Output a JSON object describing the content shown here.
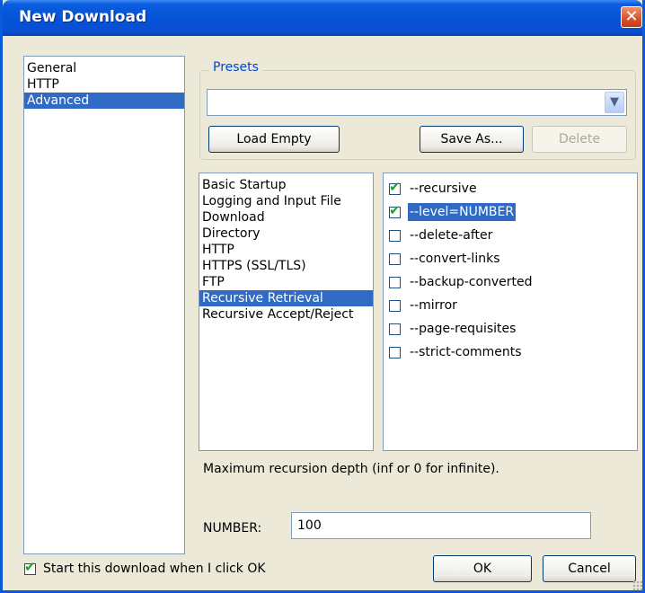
{
  "window": {
    "title": "New Download",
    "close_glyph": "✕"
  },
  "categories": [
    {
      "label": "General",
      "selected": false
    },
    {
      "label": "HTTP",
      "selected": false
    },
    {
      "label": "Advanced",
      "selected": true
    }
  ],
  "presets": {
    "legend": "Presets",
    "selected_value": "",
    "load_empty_label": "Load Empty",
    "save_as_label": "Save As...",
    "delete_label": "Delete"
  },
  "sections": [
    {
      "label": "Basic Startup",
      "selected": false
    },
    {
      "label": "Logging and Input File",
      "selected": false
    },
    {
      "label": "Download",
      "selected": false
    },
    {
      "label": "Directory",
      "selected": false
    },
    {
      "label": "HTTP",
      "selected": false
    },
    {
      "label": "HTTPS (SSL/TLS)",
      "selected": false
    },
    {
      "label": "FTP",
      "selected": false
    },
    {
      "label": "Recursive Retrieval",
      "selected": true
    },
    {
      "label": "Recursive Accept/Reject",
      "selected": false
    }
  ],
  "options": [
    {
      "label": "--recursive",
      "checked": true,
      "selected": false
    },
    {
      "label": "--level=NUMBER",
      "checked": true,
      "selected": true
    },
    {
      "label": "--delete-after",
      "checked": false,
      "selected": false
    },
    {
      "label": "--convert-links",
      "checked": false,
      "selected": false
    },
    {
      "label": "--backup-converted",
      "checked": false,
      "selected": false
    },
    {
      "label": "--mirror",
      "checked": false,
      "selected": false
    },
    {
      "label": "--page-requisites",
      "checked": false,
      "selected": false
    },
    {
      "label": "--strict-comments",
      "checked": false,
      "selected": false
    }
  ],
  "description": "Maximum recursion depth (inf or 0 for infinite).",
  "number": {
    "label": "NUMBER:",
    "value": "100"
  },
  "footer": {
    "start_label": "Start this download when I click OK",
    "start_checked": true,
    "ok_label": "OK",
    "cancel_label": "Cancel"
  },
  "colors": {
    "titlebar": "#0553d8",
    "selection": "#316ac5",
    "dialog_bg": "#ece9d8",
    "check": "#21a121"
  }
}
